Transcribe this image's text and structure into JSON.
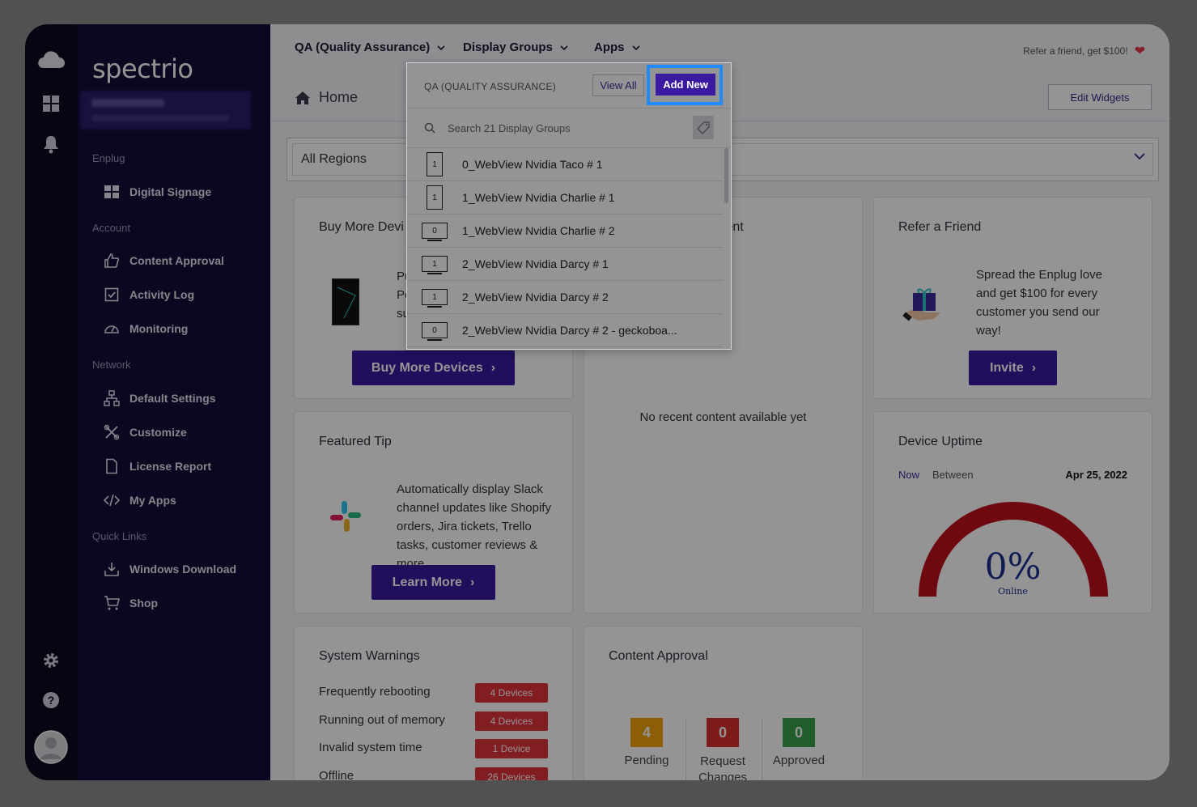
{
  "brand": {
    "logo_text": "spectrio"
  },
  "sidebar": {
    "sections": [
      {
        "title": "Enplug"
      },
      {
        "title": "Account"
      },
      {
        "title": "Network"
      },
      {
        "title": "Quick Links"
      }
    ],
    "items": [
      {
        "label": "Digital Signage",
        "icon": "grid-icon"
      },
      {
        "label": "Content Approval",
        "icon": "thumbs-up-icon"
      },
      {
        "label": "Activity Log",
        "icon": "checkbox-icon"
      },
      {
        "label": "Monitoring",
        "icon": "gauge-icon"
      },
      {
        "label": "Default Settings",
        "icon": "hierarchy-icon"
      },
      {
        "label": "Customize",
        "icon": "tools-icon"
      },
      {
        "label": "License Report",
        "icon": "document-icon"
      },
      {
        "label": "My Apps",
        "icon": "code-icon"
      },
      {
        "label": "Windows Download",
        "icon": "download-icon"
      },
      {
        "label": "Shop",
        "icon": "cart-icon"
      }
    ]
  },
  "topbar": {
    "menu": [
      {
        "label": "QA (Quality Assurance)"
      },
      {
        "label": "Display Groups"
      },
      {
        "label": "Apps"
      }
    ],
    "refer_text": "Refer a friend, get $100!",
    "breadcrumb": "Home",
    "edit_widgets": "Edit Widgets"
  },
  "regions": {
    "value": "All Regions"
  },
  "cards": {
    "buy": {
      "title": "Buy More Devi",
      "text": "Pu\nPe\nsu",
      "button": "Buy More Devices"
    },
    "content_title": "tent",
    "no_content": "No recent content available yet",
    "refer": {
      "title": "Refer a Friend",
      "text": "Spread the Enplug love and get $100 for every customer you send our way!",
      "button": "Invite"
    },
    "tip": {
      "title": "Featured Tip",
      "text": "Automatically display Slack channel updates like Shopify orders, Jira tickets, Trello tasks, customer reviews & more.",
      "button": "Learn More"
    },
    "uptime": {
      "title": "Device Uptime",
      "tab_now": "Now",
      "tab_between": "Between",
      "date": "Apr 25, 2022",
      "percent": "0%",
      "percent_value": 0,
      "online_label": "Online"
    },
    "warnings": {
      "title": "System Warnings",
      "rows": [
        {
          "label": "Frequently rebooting",
          "badge": "4 Devices"
        },
        {
          "label": "Running out of memory",
          "badge": "4 Devices"
        },
        {
          "label": "Invalid system time",
          "badge": "1 Device"
        },
        {
          "label": "Offline",
          "badge": "26 Devices"
        }
      ]
    },
    "approval": {
      "title": "Content Approval",
      "stats": [
        {
          "value": "4",
          "label": "Pending",
          "color": "#f2a20f"
        },
        {
          "value": "0",
          "label": "Request Changes",
          "color": "#d9302f"
        },
        {
          "value": "0",
          "label": "Approved",
          "color": "#3aa14a"
        }
      ]
    }
  },
  "dropdown": {
    "title": "QA (QUALITY ASSURANCE)",
    "view_all": "View All",
    "add_new": "Add New",
    "search_placeholder": "Search 21 Display Groups",
    "rows": [
      {
        "count": "1",
        "name": "0_WebView Nvidia Taco # 1",
        "orientation": "portrait"
      },
      {
        "count": "1",
        "name": "1_WebView Nvidia Charlie # 1",
        "orientation": "portrait"
      },
      {
        "count": "0",
        "name": "1_WebView Nvidia Charlie # 2",
        "orientation": "landscape"
      },
      {
        "count": "1",
        "name": "2_WebView Nvidia Darcy # 1",
        "orientation": "landscape"
      },
      {
        "count": "1",
        "name": "2_WebView Nvidia Darcy # 2",
        "orientation": "landscape"
      },
      {
        "count": "0",
        "name": "2_WebView Nvidia Darcy # 2 - geckoboa...",
        "orientation": "landscape"
      }
    ]
  },
  "colors": {
    "accent": "#3a1aa0",
    "highlight": "#1f8bff",
    "gauge": "#c0101c",
    "sidebar": "#150c3a"
  }
}
